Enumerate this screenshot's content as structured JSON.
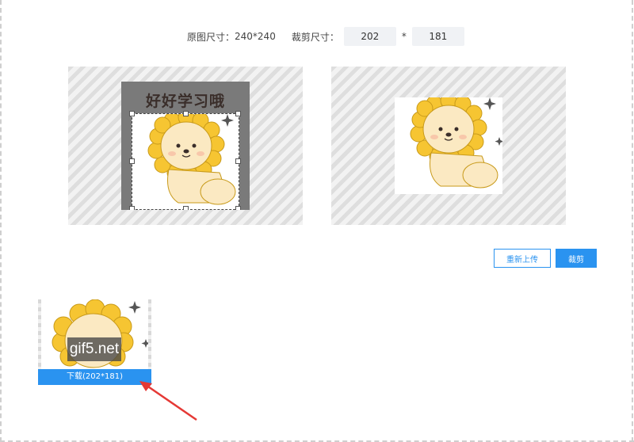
{
  "size_row": {
    "original_label": "原图尺寸：",
    "original_value": "240*240",
    "crop_label": "裁剪尺寸：",
    "width_value": "202",
    "times": "*",
    "height_value": "181"
  },
  "source": {
    "sticker_text": "好好学习哦"
  },
  "buttons": {
    "reupload": "重新上传",
    "crop": "裁剪"
  },
  "result": {
    "watermark": "gif5.net",
    "download_label": "下载(202*181)"
  },
  "colors": {
    "accent": "#2a93f0",
    "arrow": "#e53935",
    "mane": "#f6c532",
    "face": "#fbe9c2"
  },
  "icons": {
    "annotation_arrow": "arrow-icon"
  }
}
